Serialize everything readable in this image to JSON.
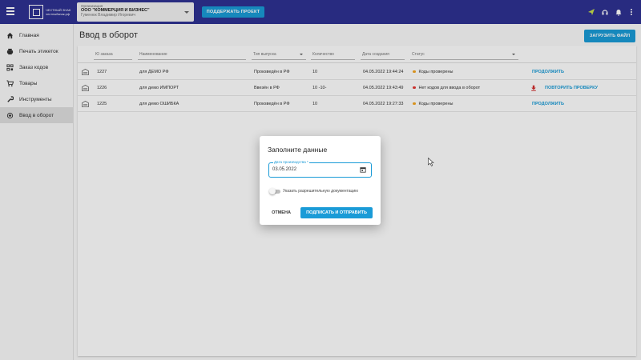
{
  "topbar": {
    "logo_text": "ЧЕСТНЫЙ ЗНАК честныйзнак.рф",
    "org_label": "Организация",
    "org_value": "ООО \"КОММЕРЦИЯ И БИЗНЕС\"",
    "org_person": "Гуменюк Владимир Игоревич",
    "support_label": "ПОДДЕРЖАТЬ ПРОЕКТ"
  },
  "sidebar": {
    "items": [
      {
        "label": "Главная",
        "icon": "home-icon"
      },
      {
        "label": "Печать этикеток",
        "icon": "printer-icon"
      },
      {
        "label": "Заказ кодов",
        "icon": "qr-icon"
      },
      {
        "label": "Товары",
        "icon": "cart-icon"
      },
      {
        "label": "Инструменты",
        "icon": "wrench-icon"
      },
      {
        "label": "Ввод в оборот",
        "icon": "circulation-icon"
      }
    ]
  },
  "main": {
    "title": "Ввод в оборот",
    "upload_label": "ЗАГРУЗИТЬ ФАЙЛ",
    "columns": [
      "Ю заказа",
      "Наименование",
      "Тип выпуска",
      "Количество",
      "Дата создания",
      "Статус"
    ],
    "rows": [
      {
        "id": "1227",
        "name": "для ДЕМО РФ",
        "type": "Произведён в РФ",
        "qty": "10",
        "date": "04.05.2022 19:44:24",
        "status": "Коды проверены",
        "status_color": "#f5a623",
        "action": "ПРОДОЛЖИТЬ",
        "has_download": false
      },
      {
        "id": "1226",
        "name": "для демо ИМПОРТ",
        "type": "Ввезён в РФ",
        "qty": "10 -10-",
        "date": "04.05.2022 19:43:49",
        "status": "Нет кодов для ввода в оборот",
        "status_color": "#e53935",
        "action": "ПОВТОРИТЬ ПРОВЕРКУ",
        "has_download": true
      },
      {
        "id": "1225",
        "name": "для демо ОШИБКА",
        "type": "Произведён в РФ",
        "qty": "10",
        "date": "04.05.2022 19:27:33",
        "status": "Коды проверены",
        "status_color": "#f5a623",
        "action": "ПРОДОЛЖИТЬ",
        "has_download": false
      }
    ]
  },
  "dialog": {
    "title": "Заполните данные",
    "date_label": "Дата производства *",
    "date_value": "03.05.2022",
    "toggle_label": "Указать разрешительную документацию",
    "cancel_label": "ОТМЕНА",
    "submit_label": "ПОДПИСАТЬ И ОТПРАВИТЬ"
  },
  "colors": {
    "topbar": "#2e3192",
    "accent": "#1a9bd7"
  }
}
